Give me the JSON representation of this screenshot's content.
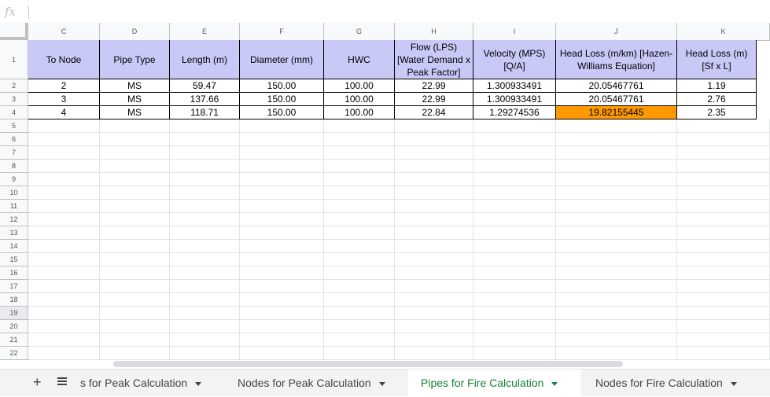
{
  "formula_bar": {
    "fx_label": "fx",
    "value": ""
  },
  "columns": [
    "C",
    "D",
    "E",
    "F",
    "G",
    "H",
    "I",
    "J",
    "K"
  ],
  "rows": [
    "1",
    "2",
    "3",
    "4",
    "5",
    "6",
    "7",
    "8",
    "9",
    "10",
    "11",
    "12",
    "13",
    "14",
    "15",
    "16",
    "17",
    "18",
    "19",
    "20",
    "21",
    "22"
  ],
  "table": {
    "headers": [
      "To Node",
      "Pipe Type",
      "Length (m)",
      "Diameter (mm)",
      "HWC",
      "Flow (LPS) [Water Demand x Peak Factor]",
      "Velocity (MPS) [Q/A]",
      "Head Loss (m/km) [Hazen-Williams Equation]",
      "Head Loss (m) [Sf x L]"
    ],
    "rows": [
      [
        "2",
        "MS",
        "59.47",
        "150.00",
        "100.00",
        "22.99",
        "1.300933491",
        "20.05467761",
        "1.19"
      ],
      [
        "3",
        "MS",
        "137.66",
        "150.00",
        "100.00",
        "22.99",
        "1.300933491",
        "20.05467761",
        "2.76"
      ],
      [
        "4",
        "MS",
        "118.71",
        "150.00",
        "100.00",
        "22.84",
        "1.29274536",
        "19.82155445",
        "2.35"
      ]
    ]
  },
  "highlight_color": "#ff9900",
  "header_fill_color": "#c9c9f8",
  "sheet_tabs": [
    {
      "label": "s for Peak Calculation",
      "active": false
    },
    {
      "label": "Nodes for Peak Calculation",
      "active": false
    },
    {
      "label": "Pipes for Fire Calculation",
      "active": true
    },
    {
      "label": "Nodes for Fire Calculation",
      "active": false
    }
  ],
  "tab_controls": {
    "add_label": "+"
  }
}
